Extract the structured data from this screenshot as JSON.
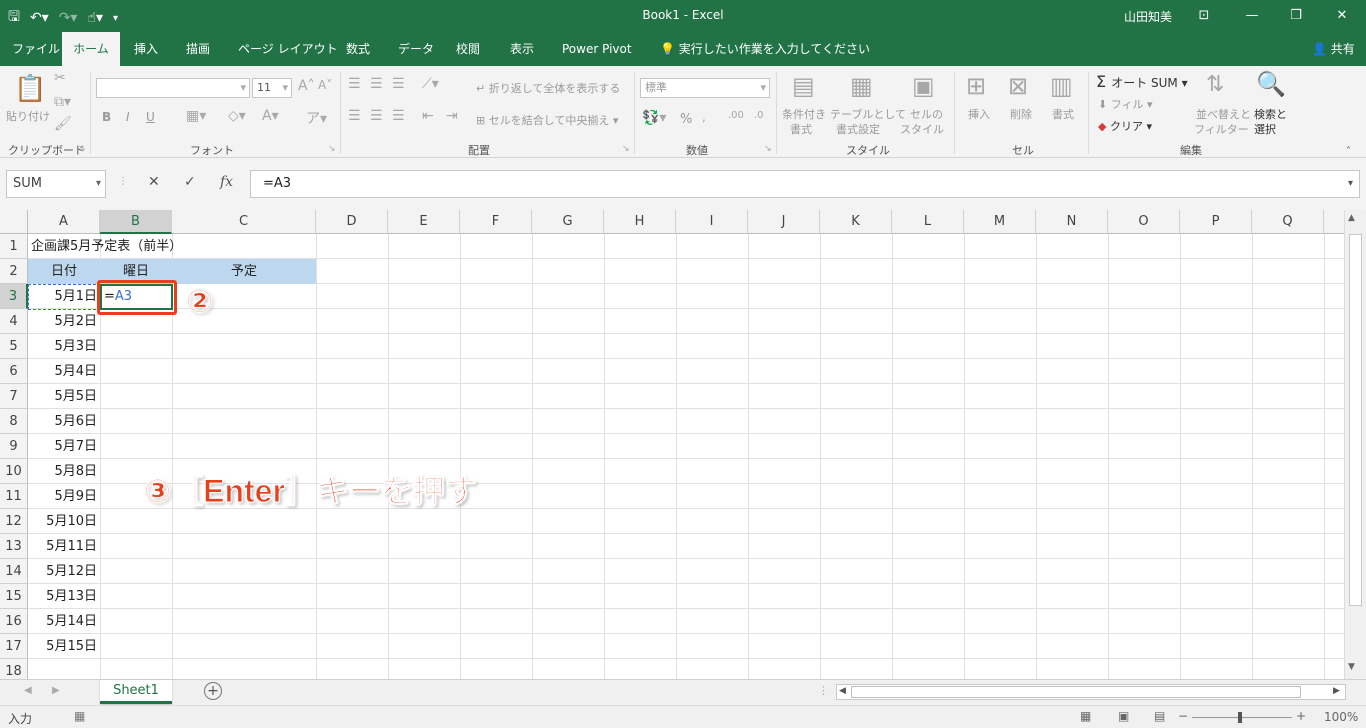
{
  "window": {
    "title": "Book1  -  Excel",
    "user": "山田知美",
    "minimize": "—",
    "restore": "❐",
    "close": "✕",
    "ribbon_display": "⊡"
  },
  "tabs": [
    "ファイル",
    "ホーム",
    "挿入",
    "描画",
    "ページ レイアウト",
    "数式",
    "データ",
    "校閲",
    "表示",
    "Power Pivot"
  ],
  "tell_me": "実行したい作業を入力してください",
  "share": "共有",
  "ribbon": {
    "clipboard": {
      "paste": "貼り付け",
      "label": "クリップボード"
    },
    "font": {
      "label": "フォント",
      "size": "11",
      "bold": "B",
      "italic": "I",
      "underline": "U"
    },
    "alignment": {
      "label": "配置",
      "wrap": "折り返して全体を表示する",
      "merge": "セルを結合して中央揃え"
    },
    "number": {
      "label": "数値",
      "format": "標準",
      "percent": "%"
    },
    "styles": {
      "label": "スタイル",
      "conditional": "条件付き",
      "conditional2": "書式",
      "table": "テーブルとして",
      "table2": "書式設定",
      "cell": "セルの",
      "cell2": "スタイル"
    },
    "cells": {
      "label": "セル",
      "insert": "挿入",
      "delete": "削除",
      "format": "書式"
    },
    "editing": {
      "label": "編集",
      "autosum": "オート SUM",
      "fill": "フィル",
      "clear": "クリア",
      "sort": "並べ替えと",
      "sort2": "フィルター",
      "find": "検索と",
      "find2": "選択"
    }
  },
  "formula_bar": {
    "name_box": "SUM",
    "formula": "=A3",
    "cancel": "✕",
    "enter": "✓",
    "fx": "fx"
  },
  "columns": [
    "A",
    "B",
    "C",
    "D",
    "E",
    "F",
    "G",
    "H",
    "I",
    "J",
    "K",
    "L",
    "M",
    "N",
    "O",
    "P",
    "Q"
  ],
  "rows": [
    "1",
    "2",
    "3",
    "4",
    "5",
    "6",
    "7",
    "8",
    "9",
    "10",
    "11",
    "12",
    "13",
    "14",
    "15",
    "16",
    "17",
    "18"
  ],
  "cells": {
    "a1": "企画課5月予定表（前半）",
    "a2": "日付",
    "b2": "曜日",
    "c2": "予定",
    "b3": "=A3",
    "dates": [
      "5月1日",
      "5月2日",
      "5月3日",
      "5月4日",
      "5月5日",
      "5月6日",
      "5月7日",
      "5月8日",
      "5月9日",
      "5月10日",
      "5月11日",
      "5月12日",
      "5月13日",
      "5月14日",
      "5月15日"
    ]
  },
  "annotations": {
    "step2": "②",
    "step3": "③［Enter］キーを押す"
  },
  "sheet_tab": "Sheet1",
  "status": {
    "mode": "入力",
    "zoom": "100%"
  },
  "colors": {
    "accent": "#217346",
    "annotation": "#e8401c",
    "header_fill": "#bdd7ee",
    "ref_blue": "#3c6fcf"
  }
}
